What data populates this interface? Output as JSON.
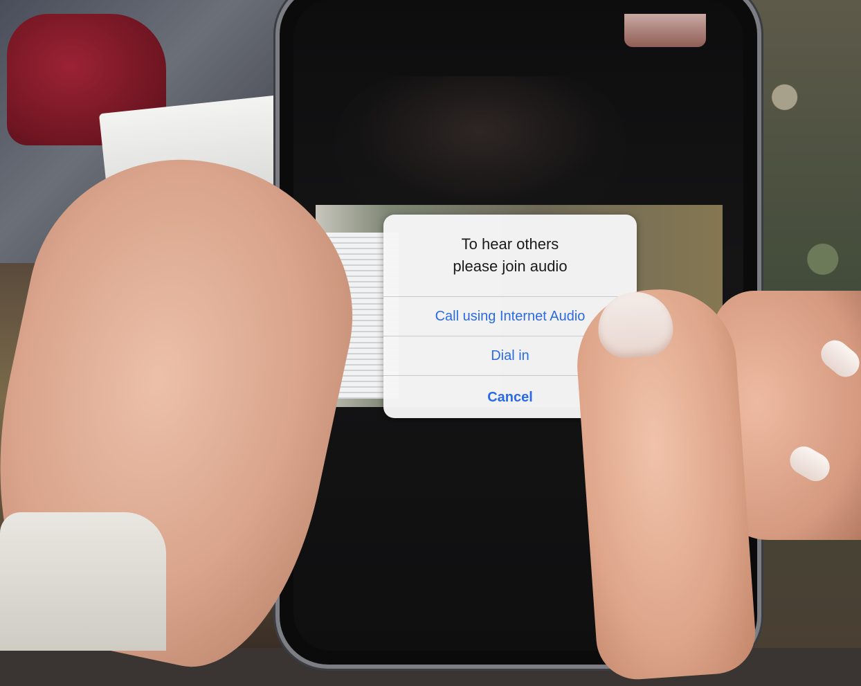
{
  "dialog": {
    "title": "To hear others\nplease join audio",
    "buttons": [
      {
        "label": "Call using Internet Audio"
      },
      {
        "label": "Dial in"
      },
      {
        "label": "Cancel"
      }
    ],
    "colors": {
      "accent": "#2a6ae6",
      "background": "#f6f6f7",
      "text": "#1a1a1a"
    }
  }
}
